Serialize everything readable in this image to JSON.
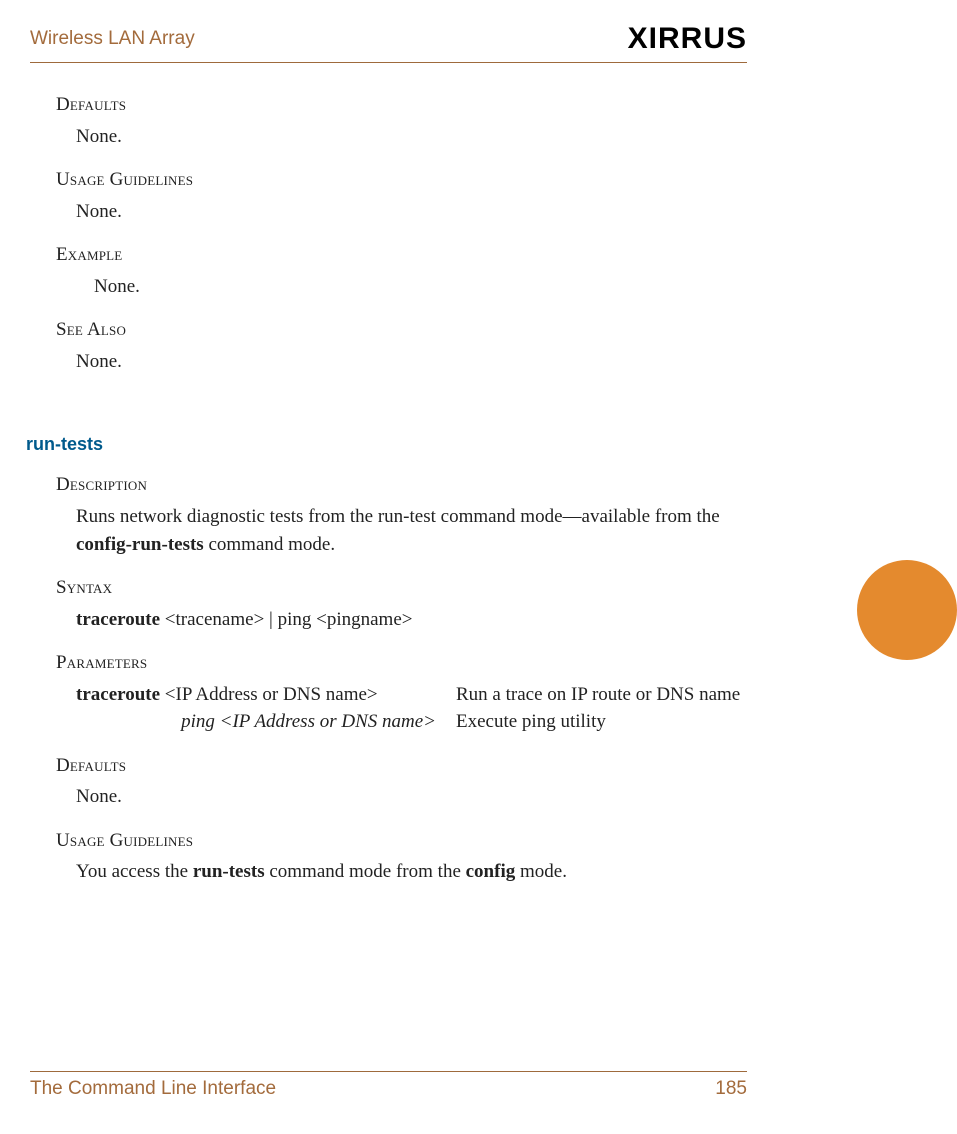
{
  "header": {
    "title": "Wireless LAN Array",
    "brand": "XIRRUS"
  },
  "sections": {
    "block1": {
      "defaults": {
        "heading": "Defaults",
        "body": "None."
      },
      "usage": {
        "heading": "Usage Guidelines",
        "body": "None."
      },
      "example": {
        "heading": "Example",
        "body": "None."
      },
      "seealso": {
        "heading": "See Also",
        "body": "None."
      }
    },
    "cmd": {
      "title": "run-tests",
      "description": {
        "heading": "Description",
        "body_pre": "Runs network diagnostic tests from the run-test command mode—available from the ",
        "body_bold": "config-run-tests",
        "body_post": " command mode."
      },
      "syntax": {
        "heading": "Syntax",
        "bold": "traceroute",
        "rest": " <tracename> | ping <pingname>"
      },
      "parameters": {
        "heading": "Parameters",
        "rows": [
          {
            "left_bold": "traceroute",
            "left_rest": " <IP Address or DNS name>",
            "right": "Run a trace on IP route or DNS name",
            "align": "left"
          },
          {
            "left_italic": "ping <IP Address or DNS name>",
            "right": "Execute ping utility",
            "align": "right"
          }
        ]
      },
      "defaults": {
        "heading": "Defaults",
        "body": "None."
      },
      "usage": {
        "heading": "Usage Guidelines",
        "pre": "You access the ",
        "b1": "run-tests",
        "mid": " command mode from the ",
        "b2": "config",
        "post": " mode."
      }
    }
  },
  "footer": {
    "left": "The Command Line Interface",
    "page": "185"
  }
}
